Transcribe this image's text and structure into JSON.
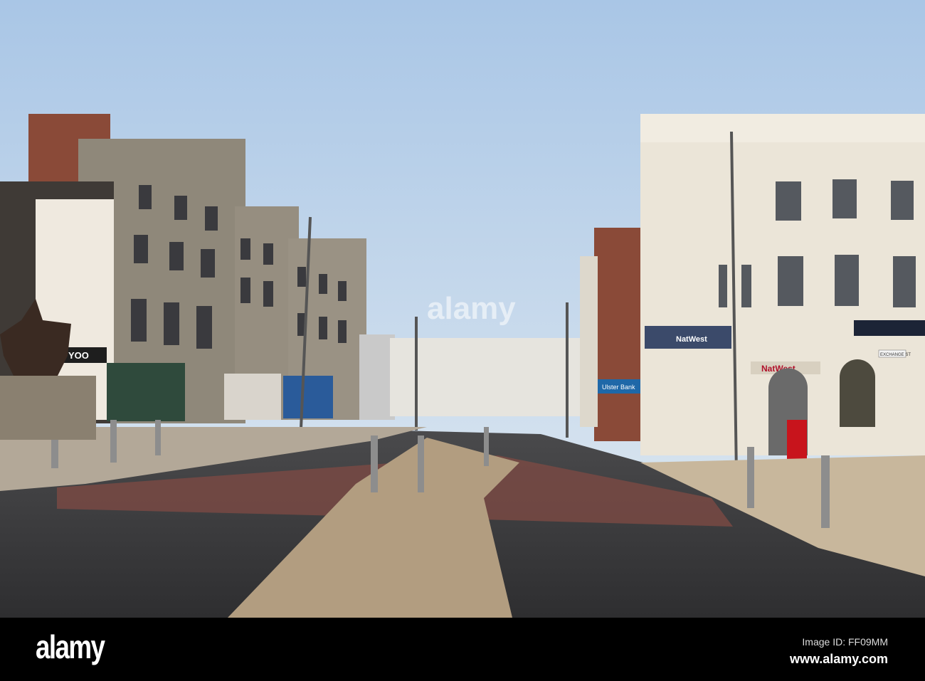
{
  "photo": {
    "signs": {
      "natwest_fascia": "NatWest",
      "natwest_entrance": "NatWest",
      "street_sign": "EXCHANGE ST",
      "bank_sign": "Ulster Bank",
      "shop_sign": "YOO"
    },
    "watermark": "alamy"
  },
  "footer": {
    "logo": "alamy",
    "image_id": "Image ID: FF09MM",
    "url": "www.alamy.com"
  }
}
